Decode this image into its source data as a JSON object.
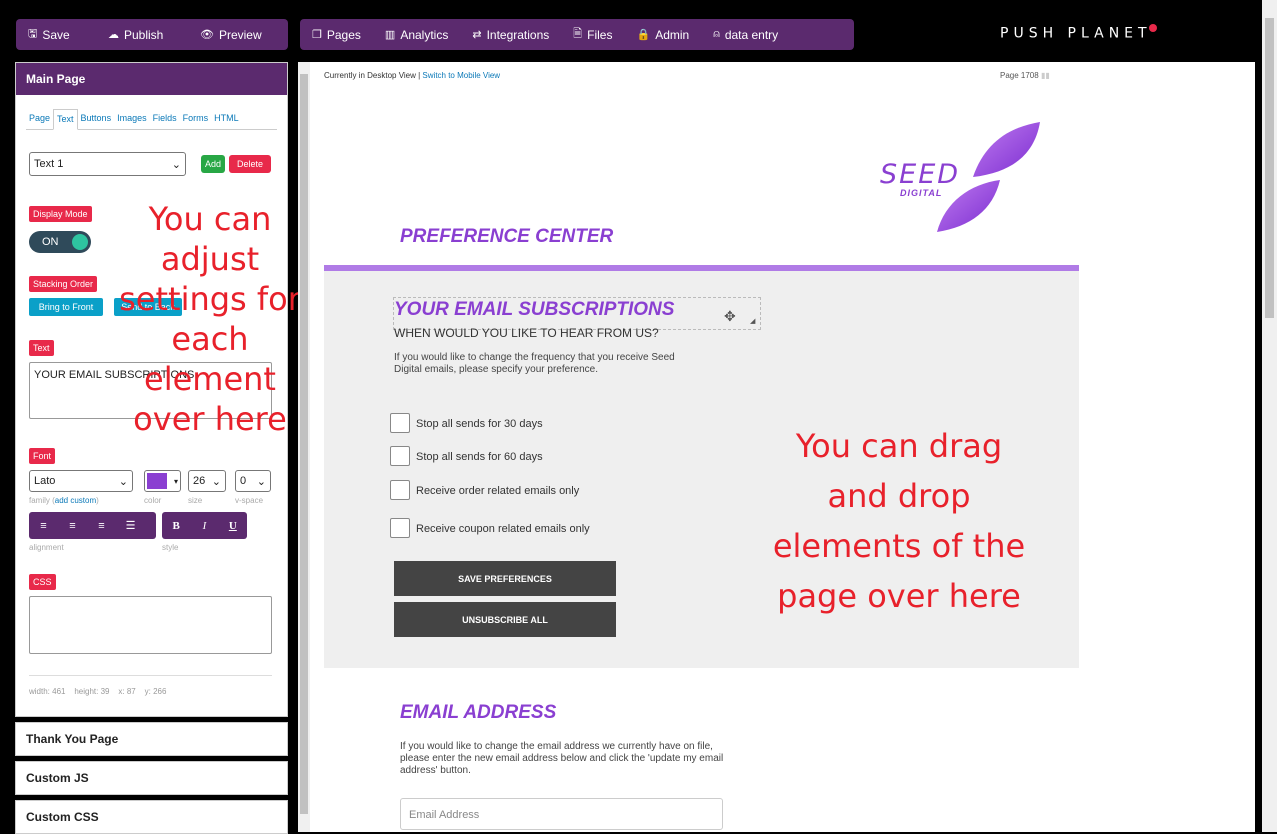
{
  "toolbar": {
    "left_group": [
      {
        "icon": "save-icon",
        "glyph": "🖫",
        "label": "Save"
      },
      {
        "icon": "cloud-upload-icon",
        "glyph": "☁",
        "label": "Publish"
      },
      {
        "icon": "eye-icon",
        "glyph": "👁",
        "label": "Preview"
      }
    ],
    "right_group": [
      {
        "icon": "pages-icon",
        "glyph": "❐",
        "label": "Pages"
      },
      {
        "icon": "analytics-icon",
        "glyph": "▥",
        "label": "Analytics"
      },
      {
        "icon": "integrations-icon",
        "glyph": "⇄",
        "label": "Integrations"
      },
      {
        "icon": "files-icon",
        "glyph": "🗎",
        "label": "Files"
      },
      {
        "icon": "admin-icon",
        "glyph": "🔒",
        "label": "Admin"
      },
      {
        "icon": "user-icon",
        "glyph": "⍝",
        "label": "data entry"
      }
    ],
    "brand": "PUSH PLANET"
  },
  "sidebar": {
    "main_title": "Main Page",
    "tabs": [
      "Page",
      "Text",
      "Buttons",
      "Images",
      "Fields",
      "Forms",
      "HTML"
    ],
    "active_tab": "Text",
    "element_select": "Text 1",
    "add_label": "Add",
    "delete_label": "Delete",
    "display_mode_label": "Display Mode",
    "toggle_label": "ON",
    "stacking_label": "Stacking Order",
    "bring_front": "Bring to Front",
    "send_back": "Send to Back",
    "text_label": "Text",
    "text_value": "YOUR EMAIL SUBSCRIPTIONS",
    "font_label": "Font",
    "font_family": "Lato",
    "font_size": "26",
    "vspace": "0",
    "cap_family": "family (",
    "cap_add_custom": "add custom",
    "cap_family_end": ")",
    "cap_color": "color",
    "cap_size": "size",
    "cap_vspace": "v-space",
    "cap_alignment": "alignment",
    "cap_style": "style",
    "css_label": "CSS",
    "dims": "width: 461    height: 39    x: 87    y: 266",
    "other_panels": [
      "Thank You Page",
      "Custom JS",
      "Custom CSS"
    ],
    "overlay_note": "You can adjust settings for each element over here"
  },
  "canvas": {
    "view_text": "Currently in Desktop View | ",
    "switch_link": "Switch to Mobile View",
    "page_info": "Page 1708",
    "logo_seed": "SEED",
    "logo_digital": "DIGITAL",
    "pref_title": "PREFERENCE CENTER",
    "subs_title": "YOUR EMAIL SUBSCRIPTIONS",
    "subs_sub": "WHEN WOULD YOU LIKE TO HEAR FROM US?",
    "subs_desc": "If you would like to change the frequency that you receive Seed Digital emails, please specify your preference.",
    "options": [
      "Stop all sends for 30 days",
      "Stop all sends for 60 days",
      "Receive order related emails only",
      "Receive coupon related emails only"
    ],
    "save_btn": "SAVE PREFERENCES",
    "unsub_btn": "UNSUBSCRIBE ALL",
    "email_title": "EMAIL ADDRESS",
    "email_desc": "If you would like to change the email address we currently have on file, please enter the new email address below and click the 'update my email address' button.",
    "email_placeholder": "Email Address",
    "overlay_note": "You can drag and drop elements of the page over here"
  },
  "colors": {
    "accent_purple": "#5b2a6e",
    "brand_purple": "#8a3fd1",
    "red": "#e8294a",
    "annotation_red": "#e8212b"
  }
}
